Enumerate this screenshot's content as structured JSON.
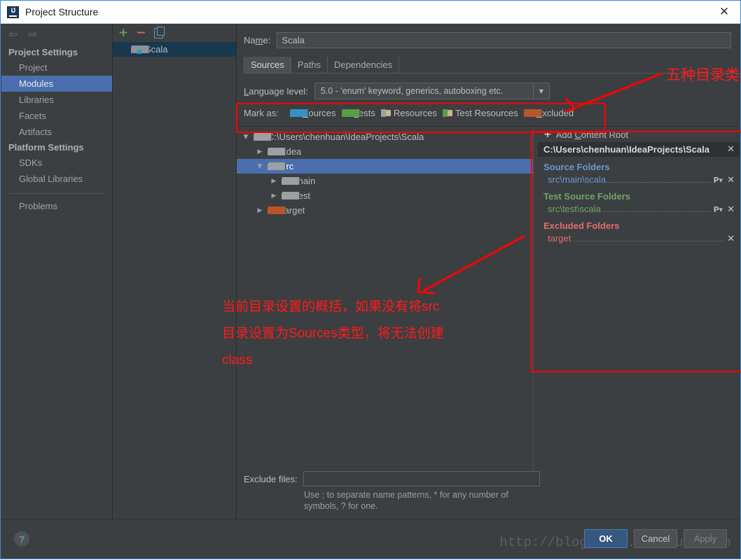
{
  "window": {
    "title": "Project Structure",
    "icon": "intellij-idea-icon",
    "close_label": "✕"
  },
  "sidebar": {
    "back_icon": "⇦",
    "forward_icon": "⇨",
    "groups": [
      {
        "label": "Project Settings",
        "items": [
          {
            "label": "Project",
            "selected": false
          },
          {
            "label": "Modules",
            "selected": true
          },
          {
            "label": "Libraries",
            "selected": false
          },
          {
            "label": "Facets",
            "selected": false
          },
          {
            "label": "Artifacts",
            "selected": false
          }
        ]
      },
      {
        "label": "Platform Settings",
        "items": [
          {
            "label": "SDKs",
            "selected": false
          },
          {
            "label": "Global Libraries",
            "selected": false
          }
        ]
      }
    ],
    "problems": {
      "label": "Problems"
    }
  },
  "module_list": {
    "toolbar": {
      "add_label": "+",
      "remove_label": "−",
      "copy_label": "copy-icon"
    },
    "modules": [
      {
        "label": "Scala",
        "selected": true,
        "icon": "module-folder-icon"
      }
    ]
  },
  "editor": {
    "name_label": "Name:",
    "name_label_pre": "Na",
    "name_label_mn": "m",
    "name_label_post": "e:",
    "name_value": "Scala",
    "tabs": [
      {
        "label": "Sources",
        "active": true
      },
      {
        "label": "Paths",
        "active": false
      },
      {
        "label": "Dependencies",
        "active": false
      }
    ],
    "language_level": {
      "label": "Language level:",
      "label_mn": "L",
      "label_rest": "anguage level:",
      "value": "5.0 - 'enum' keyword, generics, autoboxing etc.",
      "arrow": "▼"
    },
    "mark_as": {
      "label": "Mark as:",
      "items": [
        {
          "label": "Sources",
          "mn": "S",
          "rest": "ources",
          "icon": "folder-blue-icon",
          "kind": "plain",
          "color": "#3592c4"
        },
        {
          "label": "Tests",
          "mn": "T",
          "rest": "ests",
          "icon": "folder-green-icon",
          "kind": "plain",
          "color": "#5a9e42"
        },
        {
          "label": "Resources",
          "mn": "",
          "rest": "Resources",
          "icon": "folder-resources-icon",
          "kind": "res",
          "color": "#9aa0a3"
        },
        {
          "label": "Test Resources",
          "mn": "",
          "rest": "Test Resources",
          "icon": "folder-test-resources-icon",
          "kind": "res",
          "color": "#5a9e42"
        },
        {
          "label": "Excluded",
          "mn": "E",
          "rest": "xcluded",
          "icon": "folder-orange-icon",
          "kind": "plain",
          "color": "#b8552a"
        }
      ]
    },
    "tree": [
      {
        "label": "C:\\Users\\chenhuan\\IdeaProjects\\Scala",
        "depth": 0,
        "twisty": "▼",
        "icon": "folder-grey-icon",
        "selected": false
      },
      {
        "label": ".idea",
        "depth": 1,
        "twisty": "▶",
        "icon": "folder-grey-icon",
        "selected": false
      },
      {
        "label": "src",
        "depth": 1,
        "twisty": "▼",
        "icon": "folder-grey-icon",
        "selected": true
      },
      {
        "label": "main",
        "depth": 2,
        "twisty": "▶",
        "icon": "folder-grey-icon",
        "selected": false
      },
      {
        "label": "test",
        "depth": 2,
        "twisty": "▶",
        "icon": "folder-grey-icon",
        "selected": false
      },
      {
        "label": "target",
        "depth": 1,
        "twisty": "▶",
        "icon": "folder-orange-icon",
        "selected": false
      }
    ],
    "roots": {
      "add_label": "Add Content Root",
      "add_mn_pre": "Add ",
      "add_mn": "C",
      "add_rest": "ontent Root",
      "add_icon": "plus-icon",
      "content_root": {
        "path": "C:\\Users\\chenhuan\\IdeaProjects\\Scala",
        "remove_icon": "✕"
      },
      "groups": [
        {
          "title": "Source Folders",
          "kind": "src",
          "folders": [
            {
              "name": "src\\main\\scala",
              "package_btn": "P▾",
              "remove_icon": "✕"
            }
          ]
        },
        {
          "title": "Test Source Folders",
          "kind": "test",
          "folders": [
            {
              "name": "src\\test\\scala",
              "package_btn": "P▾",
              "remove_icon": "✕"
            }
          ]
        },
        {
          "title": "Excluded Folders",
          "kind": "excl",
          "folders": [
            {
              "name": "target",
              "package_btn": "",
              "remove_icon": "✕"
            }
          ]
        }
      ]
    },
    "exclude_files": {
      "label": "Exclude files:",
      "value": "",
      "hint": "Use ; to separate name patterns, * for any number of symbols, ? for one."
    }
  },
  "footer": {
    "help_label": "?",
    "buttons": [
      {
        "label": "OK",
        "primary": true,
        "disabled": false
      },
      {
        "label": "Cancel",
        "primary": false,
        "disabled": false
      },
      {
        "label": "Apply",
        "primary": false,
        "disabled": true
      }
    ],
    "watermark": "http://blog.csdn.net/huanchen"
  },
  "annotations": {
    "top_right_text": "五种目录类型",
    "paragraph_lines": [
      "当前目录设置的概括，如果没有将src",
      "目录设置为Sources类型，将无法创建",
      "class"
    ],
    "color": "#ff1a1a"
  }
}
